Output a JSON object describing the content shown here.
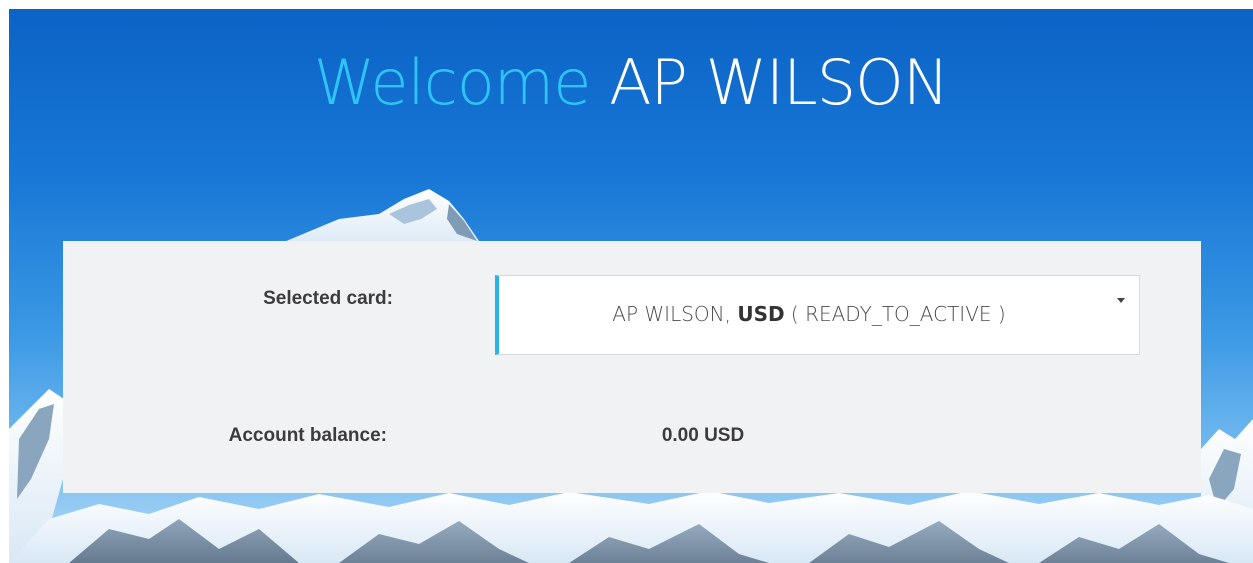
{
  "header": {
    "greeting": "Welcome",
    "user_name": "AP WILSON"
  },
  "card_panel": {
    "selected_card_label": "Selected card:",
    "selected_card": {
      "holder": "AP WILSON, ",
      "currency": "USD",
      "status": " ( READY_TO_ACTIVE )"
    },
    "balance_label": "Account balance:",
    "balance_value": "0.00 USD"
  },
  "colors": {
    "greeting": "#2ec5f6",
    "select_accent": "#29b5ea",
    "panel_bg": "#f0f2f4"
  }
}
